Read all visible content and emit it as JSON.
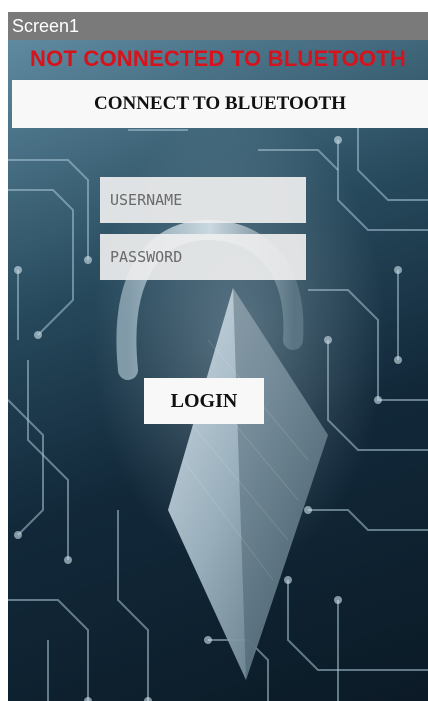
{
  "window": {
    "title": "Screen1"
  },
  "status": {
    "text": "NOT CONNECTED TO BLUETOOTH",
    "color": "#d8121b"
  },
  "buttons": {
    "connect_label": "CONNECT TO BLUETOOTH",
    "login_label": "LOGIN"
  },
  "form": {
    "username_placeholder": "USERNAME",
    "username_value": "",
    "password_placeholder": "PASSWORD",
    "password_value": ""
  },
  "background": {
    "description_icon": "padlock-circuit-board-background"
  }
}
